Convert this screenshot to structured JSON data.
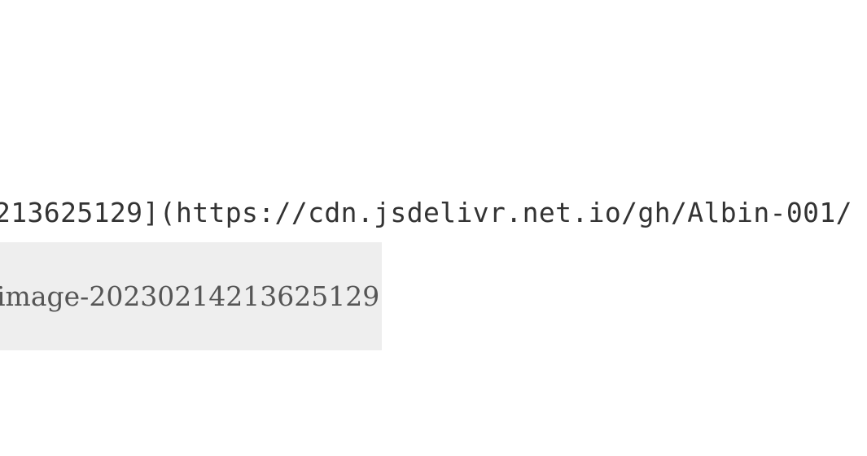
{
  "editor": {
    "markdown_source": "213625129](https://cdn.jsdelivr.net.io/gh/Albin-001/",
    "image_alt": "image-20230214213625129"
  },
  "colors": {
    "background": "#ffffff",
    "source_text": "#333333",
    "placeholder_bg": "#eeeeee",
    "placeholder_text": "#555555"
  }
}
